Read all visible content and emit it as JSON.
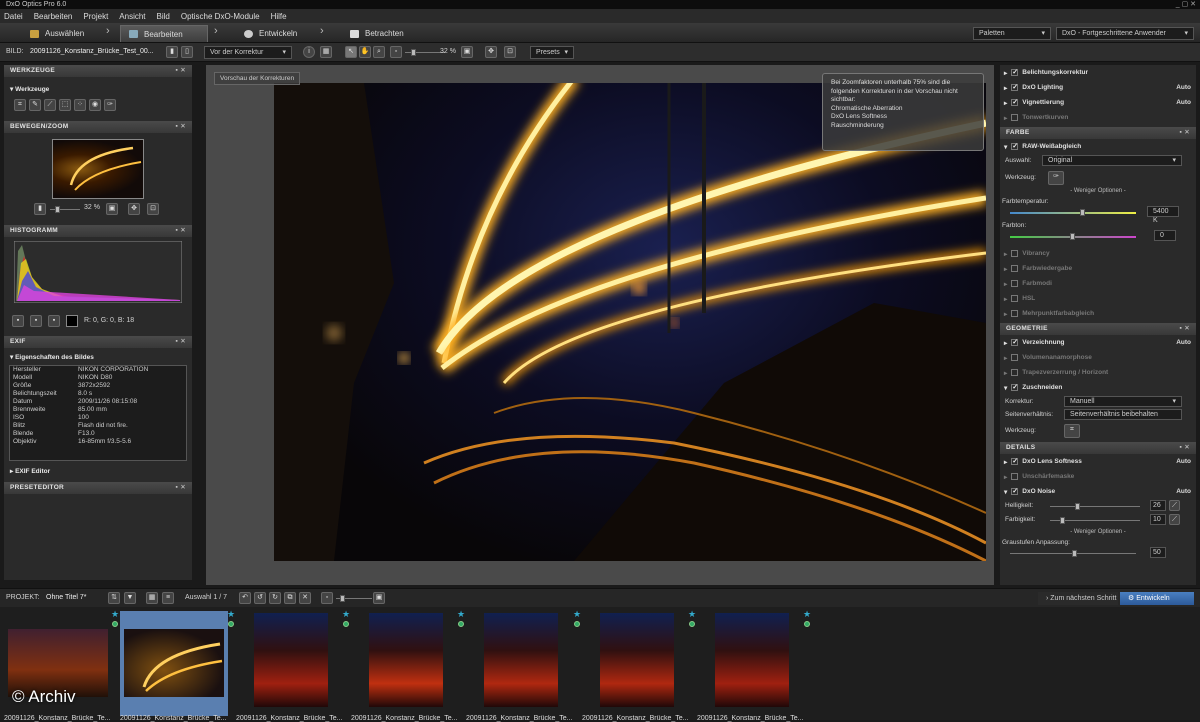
{
  "app": {
    "title": "DxO Optics Pro 6.0"
  },
  "menu": [
    "Datei",
    "Bearbeiten",
    "Projekt",
    "Ansicht",
    "Bild",
    "Optische DxO-Module",
    "Hilfe"
  ],
  "tabs": [
    {
      "label": "Auswählen"
    },
    {
      "label": "Bearbeiten"
    },
    {
      "label": "Entwickeln"
    },
    {
      "label": "Betrachten"
    }
  ],
  "topright": {
    "palettes": "Paletten",
    "workspace": "DxO - Fortgeschrittene Anwender"
  },
  "toolbar": {
    "bild_label": "BILD:",
    "filename": "20091126_Konstanz_Brücke_Test_00...",
    "compare": "Vor der Korrektur",
    "zoom": "32 %",
    "presets": "Presets"
  },
  "left": {
    "werkzeuge": "WERKZEUGE",
    "werkzeuge_sub": "Werkzeuge",
    "bewegen": "BEWEGEN/ZOOM",
    "nav_zoom": "32 %",
    "histogramm": "HISTOGRAMM",
    "rgb": "R:   0, G:  0, B:  18",
    "exif": "EXIF",
    "exif_sub": "Eigenschaften des Bildes",
    "exif_rows": [
      {
        "k": "Hersteller",
        "v": "NIKON CORPORATION"
      },
      {
        "k": "Modell",
        "v": "NIKON D80"
      },
      {
        "k": "Größe",
        "v": "3872x2592"
      },
      {
        "k": "Belichtungszeit",
        "v": "8.0 s"
      },
      {
        "k": "Datum",
        "v": "2009/11/26 08:15:08"
      },
      {
        "k": "Brennweite",
        "v": "85.00 mm"
      },
      {
        "k": "ISO",
        "v": "100"
      },
      {
        "k": "Blitz",
        "v": "Flash did not fire."
      },
      {
        "k": "Blende",
        "v": "F13.0"
      },
      {
        "k": "Objektiv",
        "v": "16-85mm f/3.5-5.6"
      }
    ],
    "exif_editor": "EXIF Editor",
    "preseteditor": "PRESETEDITOR"
  },
  "canvas": {
    "preview_badge": "Vorschau der Korrekturen",
    "tooltip": "Bei Zoomfaktoren unterhalb 75% sind die folgenden Korrekturen in der Vorschau nicht sichtbar:\nChromatische Aberration\nDxO Lens Softness\nRauschminderung"
  },
  "right": {
    "rows1": [
      {
        "label": "Belichtungskorrektur",
        "auto": ""
      },
      {
        "label": "DxO Lighting",
        "auto": "Auto"
      },
      {
        "label": "Vignettierung",
        "auto": "Auto"
      },
      {
        "label": "Tonwertkurven",
        "auto": ""
      }
    ],
    "farbe": "FARBE",
    "raw_wb": "RAW-Weißabgleich",
    "auswahl_label": "Auswahl:",
    "auswahl_value": "Original",
    "werkzeug_label": "Werkzeug:",
    "weniger": "Weniger Optionen",
    "farbtemp_label": "Farbtemperatur:",
    "farbtemp_value": "5400 K",
    "farbton_label": "Farbton:",
    "farbton_value": "0",
    "dim_rows": [
      "Vibrancy",
      "Farbwiedergabe",
      "Farbmodi",
      "HSL",
      "Mehrpunktfarbabgleich"
    ],
    "geometrie": "GEOMETRIE",
    "verzeichnung": "Verzeichnung",
    "verz_auto": "Auto",
    "geo_dim": [
      "Volumenanamorphose",
      "Trapezverzerrung / Horizont"
    ],
    "zuschneiden": "Zuschneiden",
    "korrektur_label": "Korrektur:",
    "korrektur_value": "Manuell",
    "seiten_label": "Seitenverhältnis:",
    "seiten_value": "Seitenverhältnis beibehalten",
    "werkzeug2_label": "Werkzeug:",
    "details": "DETAILS",
    "lens_softness": "DxO Lens Softness",
    "lens_auto": "Auto",
    "unscharf": "Unschärfemaske",
    "noise": "DxO Noise",
    "noise_auto": "Auto",
    "hell_label": "Helligkeit:",
    "hell_value": "26",
    "farb_label": "Farbigkeit:",
    "farb_value": "10",
    "weniger2": "Weniger Optionen",
    "grau_label": "Graustufen Anpassung:",
    "grau_value": "50"
  },
  "project": {
    "label": "PROJEKT:",
    "name": "Ohne Titel 7*",
    "auswahl": "Auswahl 1 / 7",
    "next": "Zum nächsten Schritt",
    "develop": "Entwickeln"
  },
  "thumbs": [
    "20091126_Konstanz_Brücke_Te...",
    "20091126_Konstanz_Brücke_Te...",
    "20091126_Konstanz_Brücke_Te...",
    "20091126_Konstanz_Brücke_Te...",
    "20091126_Konstanz_Brücke_Te...",
    "20091126_Konstanz_Brücke_Te...",
    "20091126_Konstanz_Brücke_Te..."
  ],
  "watermark": "© Archiv"
}
